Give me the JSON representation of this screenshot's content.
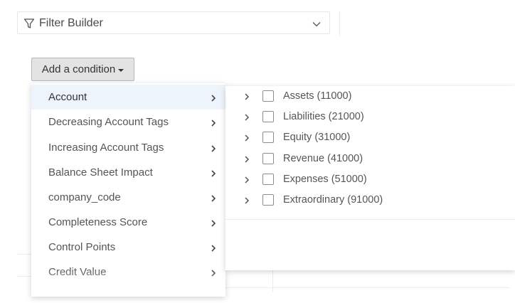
{
  "filter_builder": {
    "title": "Filter Builder",
    "icon": "funnel-icon",
    "toggle_icon": "chevron-down-icon"
  },
  "add_condition": {
    "label": "Add a condition"
  },
  "menu": {
    "items": [
      {
        "label": "Account",
        "active": true
      },
      {
        "label": "Decreasing Account Tags"
      },
      {
        "label": "Increasing Account Tags"
      },
      {
        "label": "Balance Sheet Impact"
      },
      {
        "label": "company_code"
      },
      {
        "label": "Completeness Score"
      },
      {
        "label": "Control Points"
      },
      {
        "label": "Credit Value"
      }
    ]
  },
  "submenu": {
    "items": [
      {
        "label": "Assets (11000)"
      },
      {
        "label": "Liabilities (21000)"
      },
      {
        "label": "Equity (31000)"
      },
      {
        "label": "Revenue (41000)"
      },
      {
        "label": "Expenses (51000)"
      },
      {
        "label": "Extraordinary (91000)"
      }
    ]
  },
  "colors": {
    "active_item_bg": "#eef4fb",
    "button_bg": "#e3e3e3",
    "border": "#e6e6e6"
  }
}
